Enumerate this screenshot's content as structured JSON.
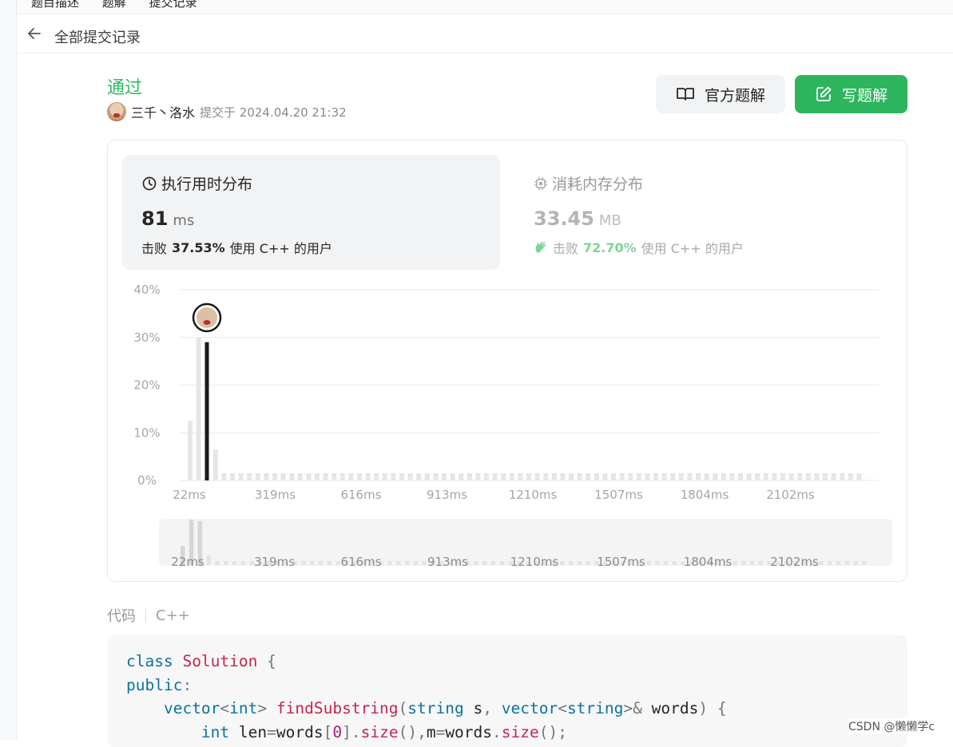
{
  "topbar": {
    "tabs": [
      "题目描述",
      "题解",
      "提交记录"
    ]
  },
  "header": {
    "back_label": "全部提交记录"
  },
  "submission": {
    "status": "通过",
    "author": "三千丶洛水",
    "submitted_at": "提交于 2024.04.20 21:32"
  },
  "buttons": {
    "official": "官方题解",
    "write": "写题解"
  },
  "runtime": {
    "title": "执行用时分布",
    "value": "81",
    "unit": "ms",
    "beats_prefix": "击败",
    "beats_pct": "37.53%",
    "beats_suffix": "使用 C++ 的用户"
  },
  "memory": {
    "title": "消耗内存分布",
    "value": "33.45",
    "unit": "MB",
    "beats_prefix": "击败",
    "beats_pct": "72.70%",
    "beats_suffix": "使用 C++ 的用户"
  },
  "chart_data": [
    {
      "type": "bar",
      "x_ticks": [
        "22ms",
        "319ms",
        "616ms",
        "913ms",
        "1210ms",
        "1507ms",
        "1804ms",
        "2102ms"
      ],
      "y_ticks": [
        "0%",
        "10%",
        "20%",
        "30%",
        "40%"
      ],
      "ylim": [
        0,
        40
      ],
      "xlim_ms": [
        22,
        2400
      ],
      "bar_step_ms": 29.7,
      "highlight_value_ms": 81,
      "highlight_pct": 29,
      "values": [
        12.5,
        30,
        29,
        6.5,
        1.5,
        1.5,
        1.5,
        1.5,
        1.5,
        1.5,
        1.5,
        1.5,
        1.5,
        1.5,
        1.5,
        1.5,
        1.5,
        1.5,
        1.5,
        1.5,
        1.5,
        1.5,
        1.5,
        1.5,
        1.5,
        1.5,
        1.5,
        1.5,
        1.5,
        1.5,
        1.5,
        1.5,
        1.5,
        1.5,
        1.5,
        1.5,
        1.5,
        1.5,
        1.5,
        1.5,
        1.5,
        1.5,
        1.5,
        1.5,
        1.5,
        1.5,
        1.5,
        1.5,
        1.5,
        1.5,
        1.5,
        1.5,
        1.5,
        1.5,
        1.5,
        1.5,
        1.5,
        1.5,
        1.5,
        1.5,
        1.5,
        1.5,
        1.5,
        1.5,
        1.5,
        1.5,
        1.5,
        1.5,
        1.5,
        1.5,
        1.5,
        1.5,
        1.5,
        1.5,
        1.5,
        1.5,
        1.5,
        1.5,
        1.5,
        1.5
      ],
      "highlight_index": 2,
      "grid": true
    },
    {
      "type": "bar",
      "x_ticks": [
        "22ms",
        "319ms",
        "616ms",
        "913ms",
        "1210ms",
        "1507ms",
        "1804ms",
        "2102ms"
      ],
      "xlim_ms": [
        22,
        2400
      ],
      "values": [
        12.5,
        30,
        29,
        6.5,
        1.5,
        1.5,
        1.5,
        1.5,
        1.5,
        1.5,
        1.5,
        1.5,
        1.5,
        1.5,
        1.5,
        1.5,
        1.5,
        1.5,
        1.5,
        1.5,
        1.5,
        1.5,
        1.5,
        1.5,
        1.5,
        1.5,
        1.5,
        1.5,
        1.5,
        1.5,
        1.5,
        1.5,
        1.5,
        1.5,
        1.5,
        1.5,
        1.5,
        1.5,
        1.5,
        1.5,
        1.5,
        1.5,
        1.5,
        1.5,
        1.5,
        1.5,
        1.5,
        1.5,
        1.5,
        1.5,
        1.5,
        1.5,
        1.5,
        1.5,
        1.5,
        1.5,
        1.5,
        1.5,
        1.5,
        1.5,
        1.5,
        1.5,
        1.5,
        1.5,
        1.5,
        1.5,
        1.5,
        1.5,
        1.5,
        1.5,
        1.5,
        1.5,
        1.5,
        1.5,
        1.5,
        1.5,
        1.5,
        1.5,
        1.5,
        1.5
      ]
    }
  ],
  "code": {
    "label": "代码",
    "language": "C++",
    "lines": [
      "class Solution {",
      "public:",
      "    vector<int> findSubstring(string s, vector<string>& words) {",
      "        int len=words[0].size(),m=words.size();"
    ]
  },
  "watermark": "CSDN @懒懒学c",
  "colors": {
    "accent_green": "#2cbb5d",
    "button_green": "#2db55d",
    "highlight_bar": "#1a1a1a"
  }
}
